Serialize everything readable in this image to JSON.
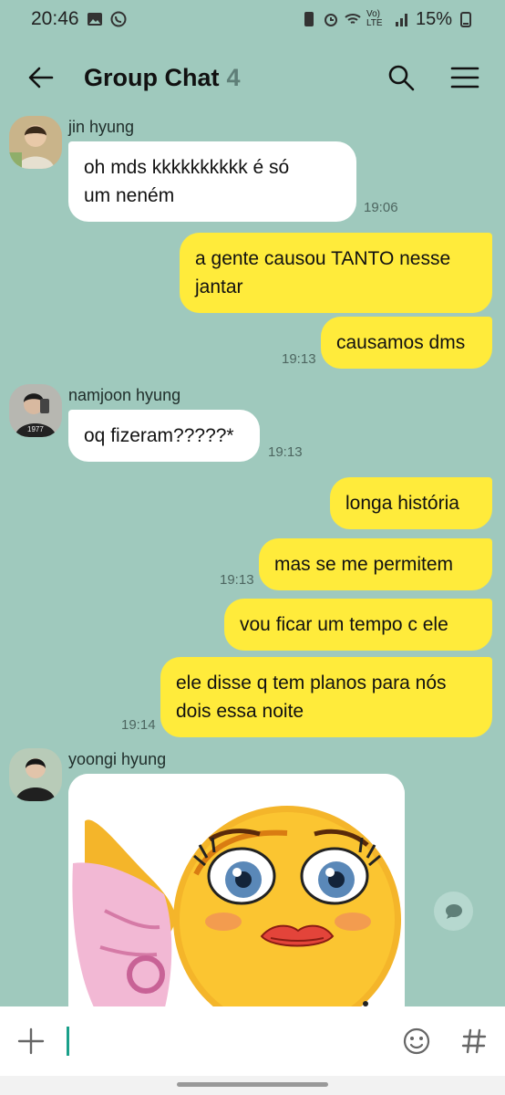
{
  "status_bar": {
    "time": "20:46",
    "battery": "15%",
    "network": "Vo) LTE"
  },
  "header": {
    "title": "Group Chat",
    "member_count": "4"
  },
  "messages": [
    {
      "sender": "jin hyung",
      "text_lines": [
        "oh mds kkkkkkkkkk é só",
        "um neném"
      ],
      "time": "19:06",
      "direction": "in"
    },
    {
      "text_lines": [
        "a gente causou TANTO nesse",
        "jantar"
      ],
      "direction": "out"
    },
    {
      "text_lines": [
        "causamos dms"
      ],
      "time": "19:13",
      "direction": "out"
    },
    {
      "sender": "namjoon hyung",
      "text_lines": [
        "oq fizeram?????*"
      ],
      "time": "19:13",
      "direction": "in"
    },
    {
      "text_lines": [
        "longa história"
      ],
      "direction": "out"
    },
    {
      "text_lines": [
        "mas se me permitem"
      ],
      "time": "19:13",
      "direction": "out"
    },
    {
      "text_lines": [
        "vou ficar um tempo c ele"
      ],
      "direction": "out"
    },
    {
      "text_lines": [
        "ele disse q tem planos para nós",
        "dois essa noite"
      ],
      "time": "19:14",
      "direction": "out"
    },
    {
      "sender": "yoongi hyung",
      "type": "image",
      "image_desc": "flirty-emoji-sticker",
      "direction": "in"
    }
  ],
  "input": {
    "placeholder": "",
    "value": ""
  },
  "colors": {
    "background": "#9fc9bd",
    "outgoing_bubble": "#ffeb3b",
    "incoming_bubble": "#ffffff",
    "caret": "#1aa08a"
  }
}
